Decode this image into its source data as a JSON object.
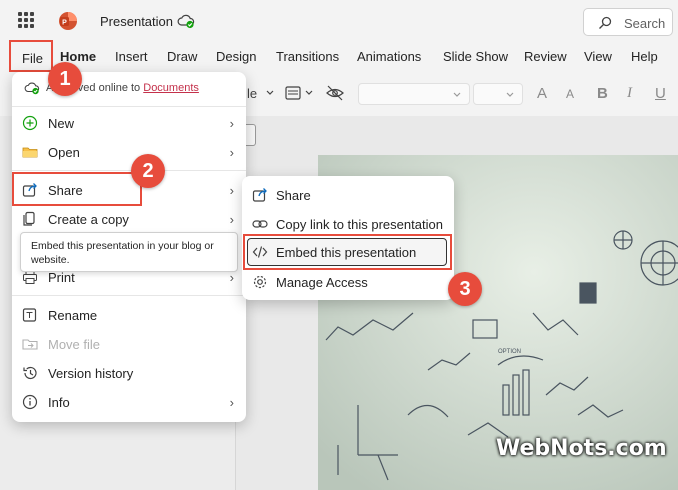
{
  "app": {
    "title": "Presentation"
  },
  "search": {
    "label": "Search"
  },
  "tabs": [
    {
      "label": "File"
    },
    {
      "label": "Home"
    },
    {
      "label": "Insert"
    },
    {
      "label": "Draw"
    },
    {
      "label": "Design"
    },
    {
      "label": "Transitions"
    },
    {
      "label": "Animations"
    },
    {
      "label": "Slide Show"
    },
    {
      "label": "Review"
    },
    {
      "label": "View"
    },
    {
      "label": "Help"
    }
  ],
  "ribbon": {
    "partial_label": "le",
    "font_size_up": "A",
    "font_size_down": "A",
    "bold": "B",
    "italic": "I",
    "underline": "U"
  },
  "file_menu": {
    "saved_prefix": "A",
    "saved_text": "ved online to",
    "saved_link": "Documents",
    "items": [
      {
        "label": "New",
        "icon": "plus-circle-icon",
        "has_submenu": true,
        "enabled": true
      },
      {
        "label": "Open",
        "icon": "folder-icon",
        "has_submenu": true,
        "enabled": true
      },
      {
        "label": "Share",
        "icon": "share-icon",
        "has_submenu": true,
        "enabled": true
      },
      {
        "label": "Create a copy",
        "icon": "copy-icon",
        "has_submenu": true,
        "enabled": true
      },
      {
        "label": "Print",
        "icon": "print-icon",
        "has_submenu": true,
        "enabled": true
      },
      {
        "label": "Rename",
        "icon": "rename-icon",
        "has_submenu": false,
        "enabled": true
      },
      {
        "label": "Move file",
        "icon": "move-file-icon",
        "has_submenu": false,
        "enabled": false
      },
      {
        "label": "Version history",
        "icon": "history-icon",
        "has_submenu": false,
        "enabled": true
      },
      {
        "label": "Info",
        "icon": "info-icon",
        "has_submenu": true,
        "enabled": true
      }
    ]
  },
  "tooltip": {
    "text": "Embed this presentation in your blog or website."
  },
  "share_submenu": {
    "items": [
      {
        "label": "Share",
        "icon": "share-icon"
      },
      {
        "label": "Copy link to this presentation",
        "icon": "link-icon"
      },
      {
        "label": "Embed this presentation",
        "icon": "code-icon"
      },
      {
        "label": "Manage Access",
        "icon": "gear-icon"
      }
    ]
  },
  "steps": [
    "1",
    "2",
    "3"
  ],
  "watermark": "WebNots.com",
  "colors": {
    "highlight": "#e74c3c",
    "link": "#c4314b",
    "background": "#f3f3f3"
  }
}
